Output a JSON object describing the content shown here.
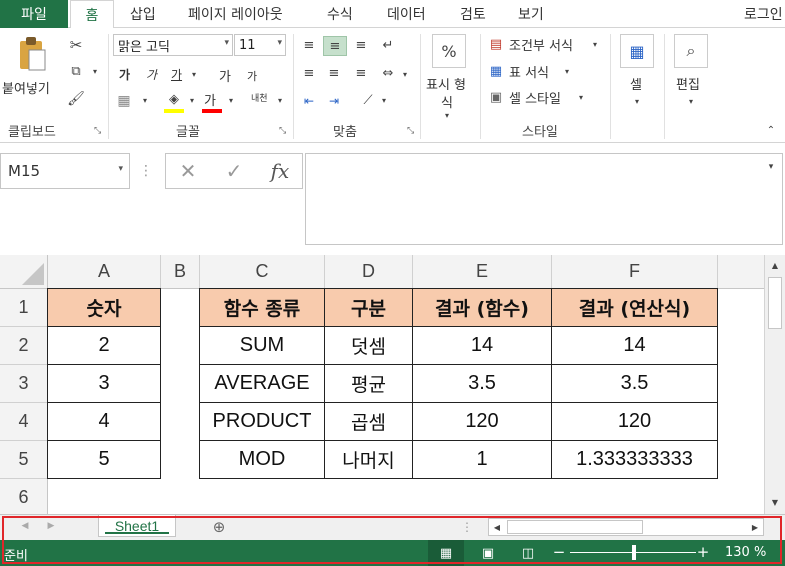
{
  "ribbon_tabs": {
    "file": "파일",
    "items": [
      "홈",
      "삽입",
      "페이지 레이아웃",
      "수식",
      "데이터",
      "검토",
      "보기"
    ],
    "login": "로그인"
  },
  "ribbon": {
    "clipboard": {
      "paste": "붙여넣기",
      "label": "클립보드"
    },
    "font": {
      "name": "맑은 고딕",
      "size": "11",
      "bold": "가",
      "italic": "가",
      "underline": "가",
      "grow": "가",
      "shrink": "가",
      "color_letter": "가",
      "phonetic": "내천",
      "label": "글꼴"
    },
    "align": {
      "label": "맞춤"
    },
    "number": {
      "line1": "표시 형",
      "line2": "식",
      "label": ""
    },
    "styles": {
      "conditional": "조건부 서식",
      "table": "표 서식",
      "cell": "셀 스타일",
      "label": "스타일"
    },
    "cells": {
      "label": "셀"
    },
    "edit": {
      "label": "편집"
    }
  },
  "formula_bar": {
    "name_box": "M15",
    "fx": "fx"
  },
  "grid": {
    "columns": [
      "A",
      "B",
      "C",
      "D",
      "E",
      "F"
    ],
    "rows": [
      "1",
      "2",
      "3",
      "4",
      "5",
      "6"
    ],
    "cells": {
      "A1": "숫자",
      "A2": "2",
      "A3": "3",
      "A4": "4",
      "A5": "5",
      "C1": "함수 종류",
      "C2": "SUM",
      "C3": "AVERAGE",
      "C4": "PRODUCT",
      "C5": "MOD",
      "D1": "구분",
      "D2": "덧셈",
      "D3": "평균",
      "D4": "곱셈",
      "D5": "나머지",
      "E1": "결과 (함수)",
      "E2": "14",
      "E3": "3.5",
      "E4": "120",
      "E5": "1",
      "F1": "결과 (연산식)",
      "F2": "14",
      "F3": "3.5",
      "F4": "120",
      "F5": "1.333333333"
    }
  },
  "sheets": {
    "active": "Sheet1"
  },
  "status": {
    "ready": "준비",
    "zoom": "130 %"
  },
  "colors": {
    "accent": "#217346",
    "header_fill": "#F8CBAD",
    "highlight": "#E0262A"
  }
}
